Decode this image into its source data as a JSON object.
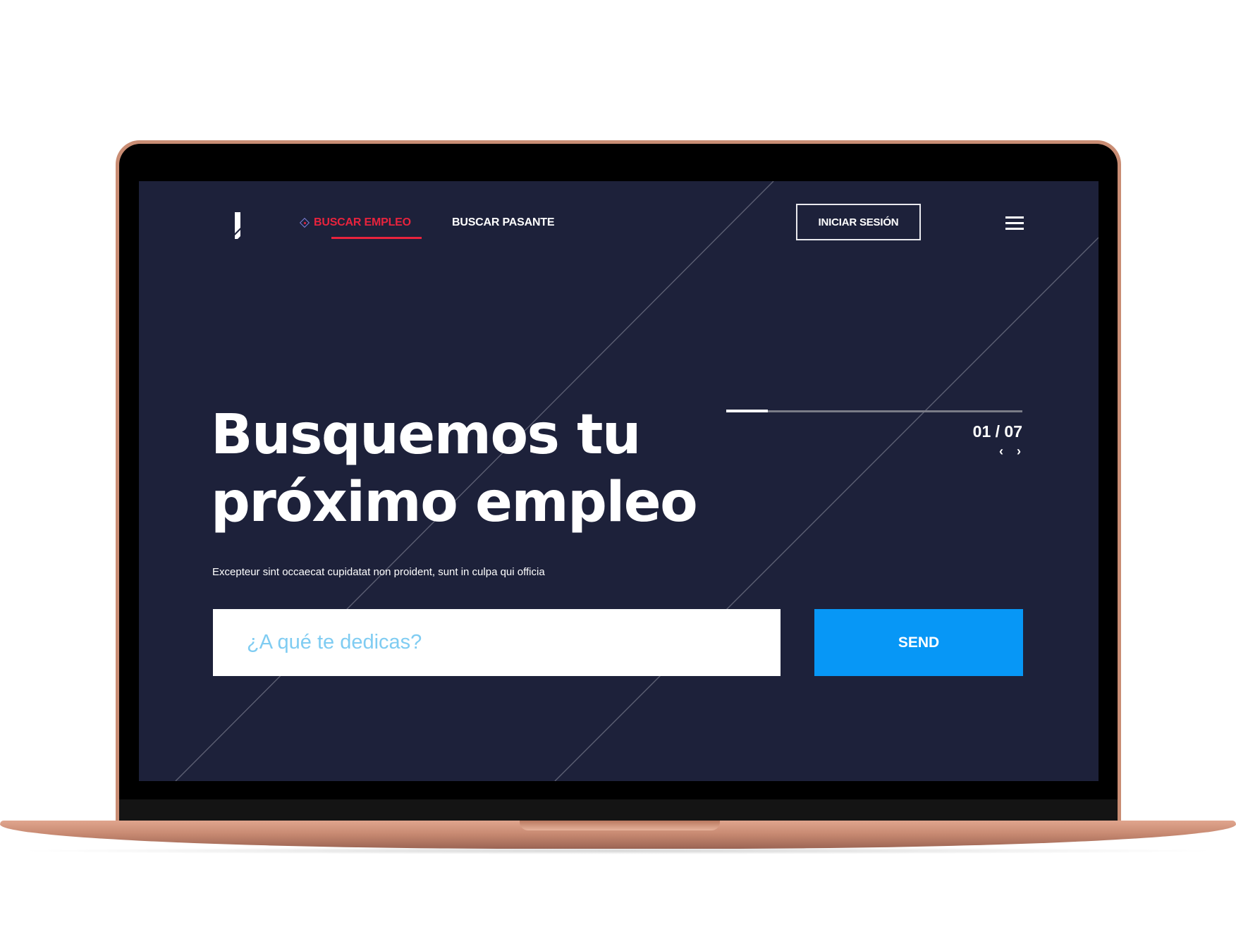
{
  "nav": {
    "items": [
      {
        "label": "BUSCAR EMPLEO",
        "active": true
      },
      {
        "label": "BUSCAR PASANTE",
        "active": false
      }
    ],
    "login_label": "INICIAR SESIÓN"
  },
  "slider": {
    "counter": "01 / 07",
    "progress": 0.14
  },
  "hero": {
    "title_line1": "Busquemos tu",
    "title_line2": "próximo empleo",
    "subtitle": "Excepteur sint occaecat cupidatat non proident, sunt in culpa qui officia"
  },
  "search": {
    "placeholder": "¿A qué te dedicas?",
    "value": "",
    "button_label": "SEND"
  },
  "icons": {
    "logo": "logo-mark",
    "nav_marker": "diamond-icon",
    "menu": "hamburger-menu-icon",
    "prev": "chevron-left-icon",
    "next": "chevron-right-icon"
  },
  "colors": {
    "screen_bg": "#1d213a",
    "accent_red": "#e8233d",
    "accent_blue": "#0797f6",
    "placeholder": "#7fccf2",
    "laptop_frame": "#c98d74"
  }
}
